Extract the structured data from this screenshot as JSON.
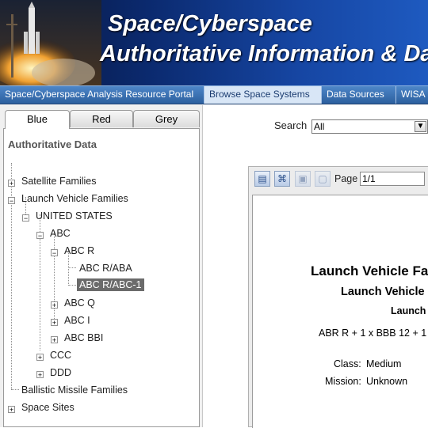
{
  "banner": {
    "title_line1": "Space/Cyberspace",
    "title_line2": "Authoritative Information & Da"
  },
  "nav": [
    {
      "label": "Space/Cyberspace Analysis Resource Portal",
      "active": false
    },
    {
      "label": "Browse Space Systems",
      "active": true
    },
    {
      "label": "Data Sources",
      "active": false
    },
    {
      "label": "WISA",
      "active": false
    }
  ],
  "tabs": [
    "Blue",
    "Red",
    "Grey"
  ],
  "tree": {
    "section_title": "Authoritative Data",
    "items": {
      "satellite": "Satellite Families",
      "launch": "Launch Vehicle Families",
      "us": "UNITED STATES",
      "abc": "ABC",
      "abcr": "ABC R",
      "abcr_aba": "ABC R/ABA",
      "abcr_abc1": "ABC R/ABC-1",
      "abcq": "ABC Q",
      "abci": "ABC I",
      "abcbbi": "ABC BBI",
      "ccc": "CCC",
      "ddd": "DDD",
      "ballistic": "Ballistic Missile Families",
      "sites": "Space Sites"
    }
  },
  "search": {
    "label": "Search",
    "value": "All"
  },
  "viewer": {
    "page_label": "Page",
    "page_value": "1/1"
  },
  "report": {
    "title": "Launch Vehicle Fa",
    "subtitle": "Launch Vehicle",
    "subtitle2": "Launch",
    "config": "ABR R + 1 x BBB 12 + 1 x",
    "class_label": "Class:",
    "class_value": "Medium",
    "mission_label": "Mission:",
    "mission_value": "Unknown"
  }
}
